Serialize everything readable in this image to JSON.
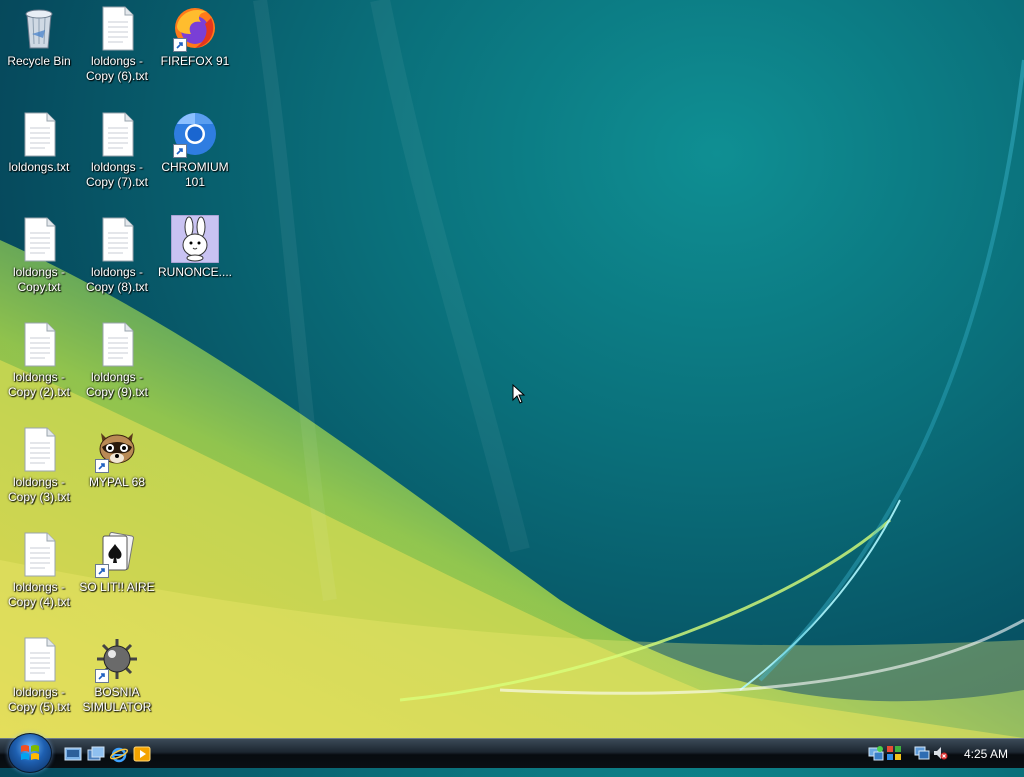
{
  "desktop": {
    "icons": {
      "recycle_bin": "Recycle Bin",
      "copy6": "loldongs - Copy (6).txt",
      "firefox": "FIREFOX 91",
      "loldongs": "loldongs.txt",
      "copy7": "loldongs - Copy (7).txt",
      "chromium": "CHROMIUM 101",
      "copy": "loldongs - Copy.txt",
      "copy8": "loldongs - Copy (8).txt",
      "runonce": "RUNONCE....",
      "copy2": "loldongs - Copy (2).txt",
      "copy9": "loldongs - Copy (9).txt",
      "copy3": "loldongs - Copy (3).txt",
      "mypal": "MYPAL 68",
      "copy4": "loldongs - Copy (4).txt",
      "solitaire": "SO LIT!! AIRE",
      "copy5": "loldongs - Copy (5).txt",
      "bosnia": "BOSNIA SIMULATOR"
    }
  },
  "taskbar": {
    "clock": "4:25 AM",
    "quick_launch": [
      "show-desktop-icon",
      "switch-windows-icon",
      "internet-explorer-icon",
      "media-player-icon"
    ],
    "tray": [
      "network-sync-icon",
      "security-icon",
      "network-icon",
      "volume-muted-icon"
    ]
  },
  "colors": {
    "accent": "#0a6f7a",
    "taskbar": "#0a0f14"
  }
}
